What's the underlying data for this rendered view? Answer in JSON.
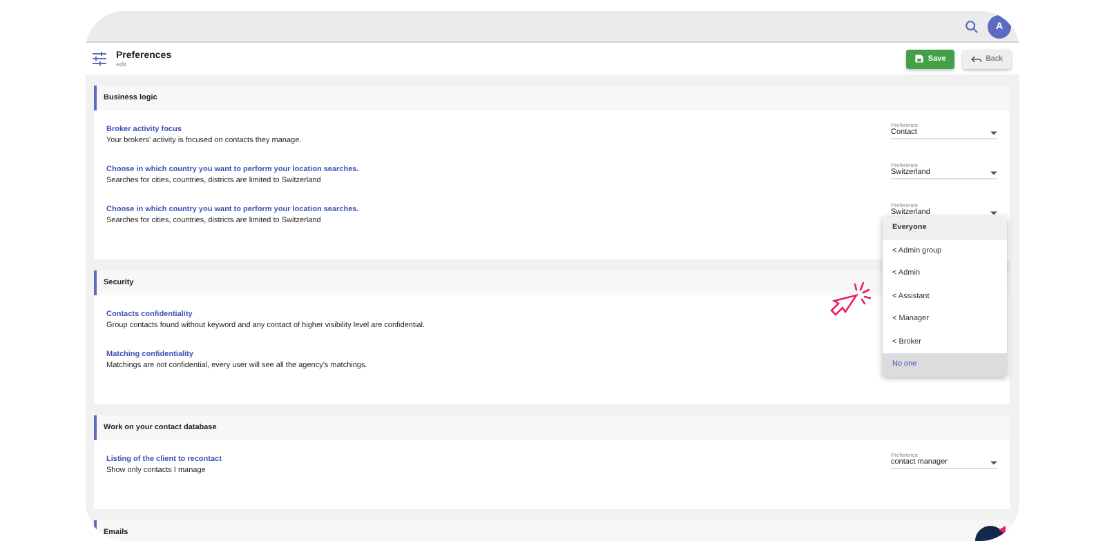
{
  "topbar": {
    "avatar": "A"
  },
  "header": {
    "title": "Preferences",
    "subtitle": "edit",
    "buttons": [
      {
        "label": "Save",
        "kind": "primary"
      },
      {
        "label": "Back",
        "kind": "secondary"
      }
    ]
  },
  "sections": [
    {
      "title": "Business logic",
      "rows": [
        {
          "title": "Broker activity focus",
          "description": "Your brokers' activity is focused on contacts they manage.",
          "select": {
            "label": "Preference",
            "value": "Contact"
          }
        },
        {
          "title": "Choose in which country you want to perform your location searches.",
          "description": "Searches for cities, countries, districts are limited to Switzerland",
          "select": {
            "label": "Preference",
            "value": "Switzerland"
          }
        },
        {
          "title": "Choose in which country you want to perform your location searches.",
          "description": "Searches for cities, countries, districts are limited to Switzerland",
          "select": {
            "label": "Preference",
            "value": "Switzerland"
          }
        }
      ]
    },
    {
      "title": "Security",
      "rows": [
        {
          "title": "Contacts confidentiality",
          "description": "Group contacts found without keyword and any contact of higher visibility level are confidential."
        },
        {
          "title": "Matching confidentiality",
          "description": "Matchings are not confidential, every user will see all the agency's matchings."
        }
      ]
    },
    {
      "title": "Work on your contact database",
      "rows": [
        {
          "title": "Listing of the client to recontact",
          "description": "Show only contacts I manage",
          "select": {
            "label": "Preference",
            "value": "contact manager"
          }
        }
      ]
    },
    {
      "title": "Emails"
    }
  ],
  "dropdown": {
    "options": [
      {
        "label": "Everyone",
        "focused": true,
        "selected": false
      },
      {
        "label": "< Admin group",
        "focused": false,
        "selected": false
      },
      {
        "label": "< Admin",
        "focused": false,
        "selected": false
      },
      {
        "label": "< Assistant",
        "focused": false,
        "selected": false
      },
      {
        "label": "< Manager",
        "focused": false,
        "selected": false
      },
      {
        "label": "< Broker",
        "focused": false,
        "selected": false
      },
      {
        "label": "No one",
        "focused": false,
        "selected": true
      }
    ]
  }
}
